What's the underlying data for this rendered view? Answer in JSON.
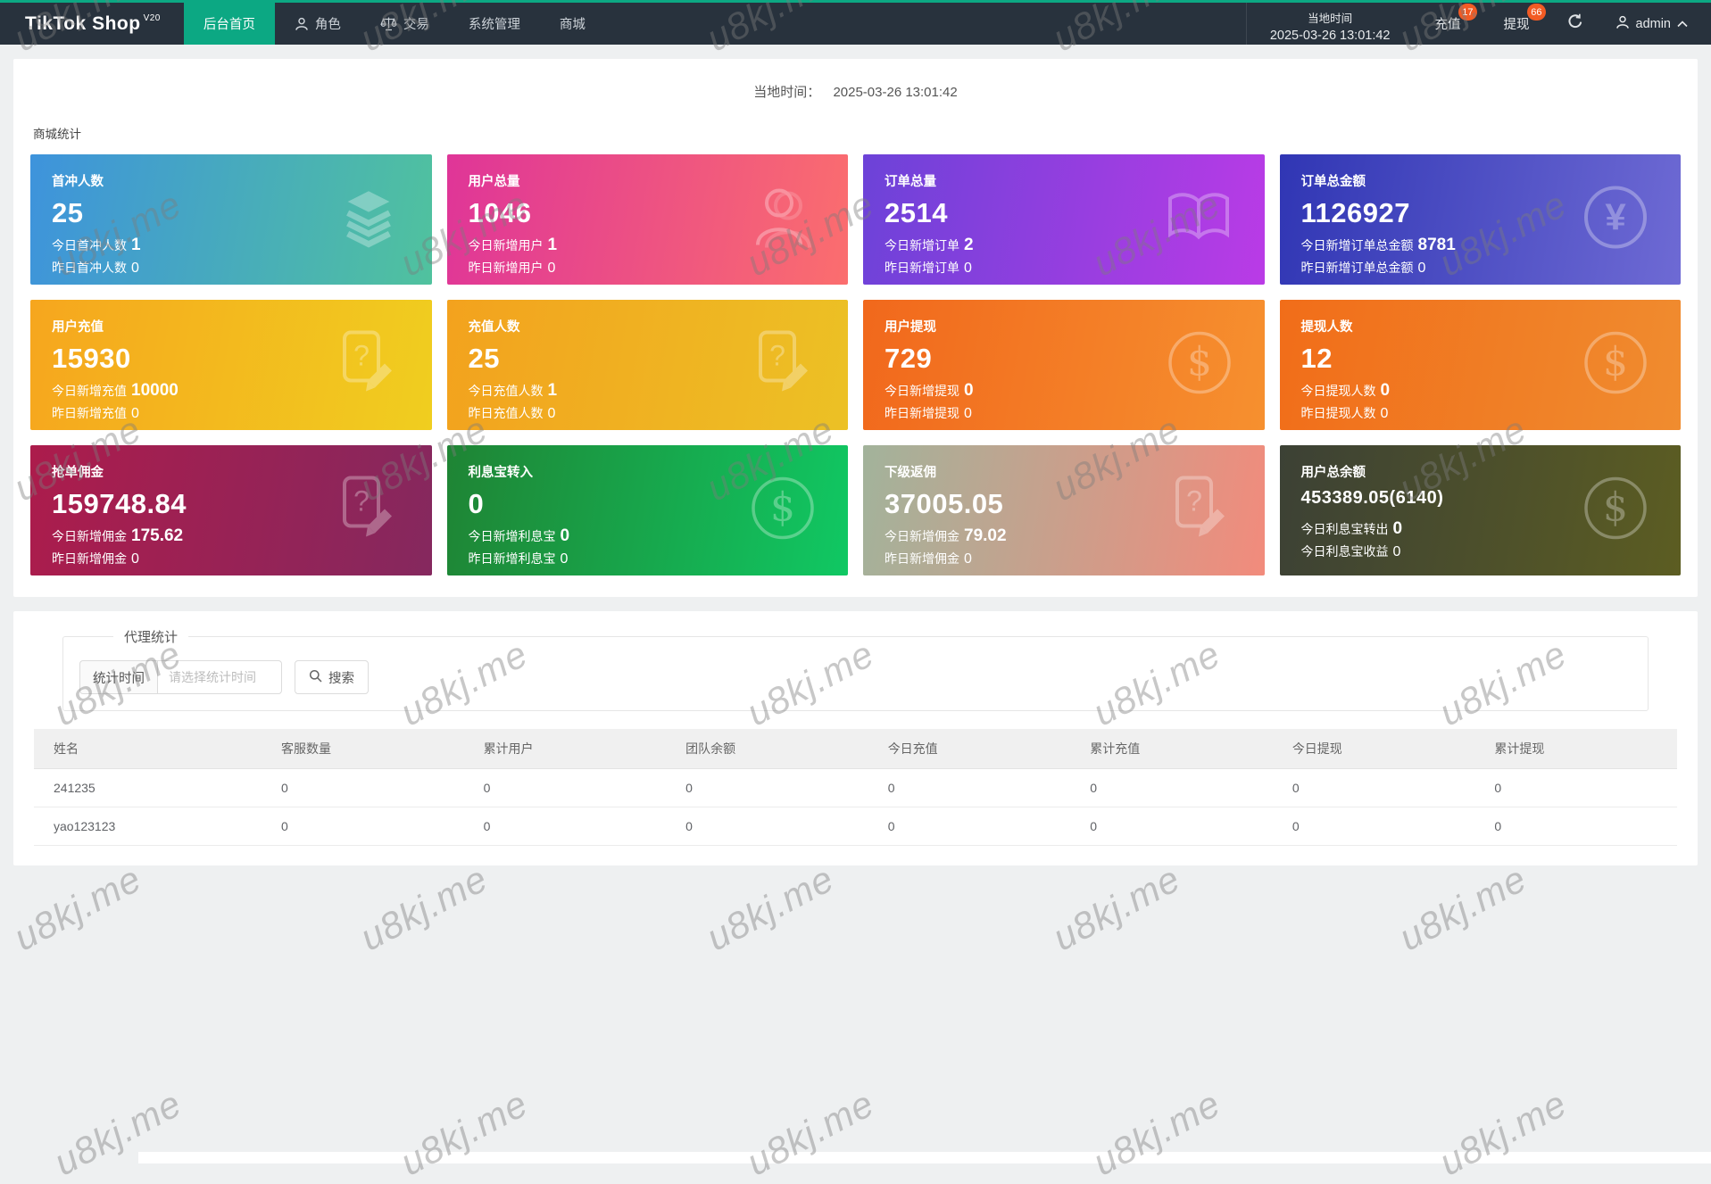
{
  "colors": {
    "accent": "#0CA883",
    "badge": "#F25B24",
    "navbar": "#28323D"
  },
  "topbar": {
    "brand": "TikTok Shop",
    "brand_sup": "V20",
    "nav": [
      {
        "label": "后台首页",
        "active": true
      },
      {
        "label": "角色",
        "icon": "user"
      },
      {
        "label": "交易",
        "icon": "scales"
      },
      {
        "label": "系统管理"
      },
      {
        "label": "商城"
      }
    ],
    "clock_label": "当地时间",
    "clock_time": "2025-03-26 13:01:42",
    "recharge_label": "充值",
    "recharge_badge": "17",
    "withdraw_label": "提现",
    "withdraw_badge": "66",
    "username": "admin"
  },
  "header": {
    "local_time_label": "当地时间：",
    "local_time_value": "2025-03-26 13:01:42"
  },
  "stats": {
    "section_title": "商城统计",
    "cards": [
      {
        "title": "首冲人数",
        "value": "25",
        "line1_label": "今日首冲人数",
        "line1_value": "1",
        "line2_label": "昨日首冲人数",
        "line2_value": "0",
        "icon": "layers",
        "gradient": [
          "#3E93DC",
          "#50C29E"
        ]
      },
      {
        "title": "用户总量",
        "value": "1046",
        "line1_label": "今日新增用户",
        "line1_value": "1",
        "line2_label": "昨日新增用户",
        "line2_value": "0",
        "icon": "user",
        "gradient": [
          "#DF3598",
          "#FB6E6E"
        ]
      },
      {
        "title": "订单总量",
        "value": "2514",
        "line1_label": "今日新增订单",
        "line1_value": "2",
        "line2_label": "昨日新增订单",
        "line2_value": "0",
        "icon": "book",
        "gradient": [
          "#6C42D8",
          "#BA3BE6"
        ]
      },
      {
        "title": "订单总金额",
        "value": "1126927",
        "line1_label": "今日新增订单总金额",
        "line1_value": "8781",
        "line2_label": "昨日新增订单总金额",
        "line2_value": "0",
        "icon": "yen",
        "gradient": [
          "#3036B4",
          "#6E6AD4"
        ]
      },
      {
        "title": "用户充值",
        "value": "15930",
        "line1_label": "今日新增充值",
        "line1_value": "10000",
        "line2_label": "昨日新增充值",
        "line2_value": "0",
        "icon": "doc",
        "gradient": [
          "#F6A61E",
          "#F0CE1F"
        ]
      },
      {
        "title": "充值人数",
        "value": "25",
        "line1_label": "今日充值人数",
        "line1_value": "1",
        "line2_label": "昨日充值人数",
        "line2_value": "0",
        "icon": "doc",
        "gradient": [
          "#F3A21E",
          "#ECC125"
        ]
      },
      {
        "title": "用户提现",
        "value": "729",
        "line1_label": "今日新增提现",
        "line1_value": "0",
        "line2_label": "昨日新增提现",
        "line2_value": "0",
        "icon": "dollar",
        "gradient": [
          "#F1681C",
          "#F6902F"
        ]
      },
      {
        "title": "提现人数",
        "value": "12",
        "line1_label": "今日提现人数",
        "line1_value": "0",
        "line2_label": "昨日提现人数",
        "line2_value": "0",
        "icon": "dollar",
        "gradient": [
          "#F16D19",
          "#F08C2F"
        ]
      },
      {
        "title": "抢单佣金",
        "value": "159748.84",
        "line1_label": "今日新增佣金",
        "line1_value": "175.62",
        "line2_label": "昨日新增佣金",
        "line2_value": "0",
        "icon": "doc",
        "gradient": [
          "#AC1C4C",
          "#85285E"
        ]
      },
      {
        "title": "利息宝转入",
        "value": "0",
        "line1_label": "今日新增利息宝",
        "line1_value": "0",
        "line2_label": "昨日新增利息宝",
        "line2_value": "0",
        "icon": "dollar",
        "gradient": [
          "#1F8434",
          "#10C863"
        ]
      },
      {
        "title": "下级返佣",
        "value": "37005.05",
        "line1_label": "今日新增佣金",
        "line1_value": "79.02",
        "line2_label": "昨日新增佣金",
        "line2_value": "0",
        "icon": "doc",
        "gradient": [
          "#A2B39B",
          "#F28B7C"
        ]
      },
      {
        "title": "用户总余额",
        "value": "453389.05(6140)",
        "small": true,
        "line1_label": "今日利息宝转出",
        "line1_value": "0",
        "line2_label": "今日利息宝收益",
        "line2_value": "0",
        "icon": "dollar",
        "gradient": [
          "#3C4135",
          "#5C5D22"
        ]
      }
    ]
  },
  "agent": {
    "section_title": "代理统计",
    "filter_label": "统计时间",
    "filter_placeholder": "请选择统计时间",
    "search_label": "搜索",
    "table": {
      "headers": [
        "姓名",
        "客服数量",
        "累计用户",
        "团队余额",
        "今日充值",
        "累计充值",
        "今日提现",
        "累计提现"
      ],
      "rows": [
        [
          "241235",
          "0",
          "0",
          "0",
          "0",
          "0",
          "0",
          "0"
        ],
        [
          "yao123123",
          "0",
          "0",
          "0",
          "0",
          "0",
          "0",
          "0"
        ]
      ]
    }
  },
  "watermark": {
    "text": "u8kj.me"
  }
}
